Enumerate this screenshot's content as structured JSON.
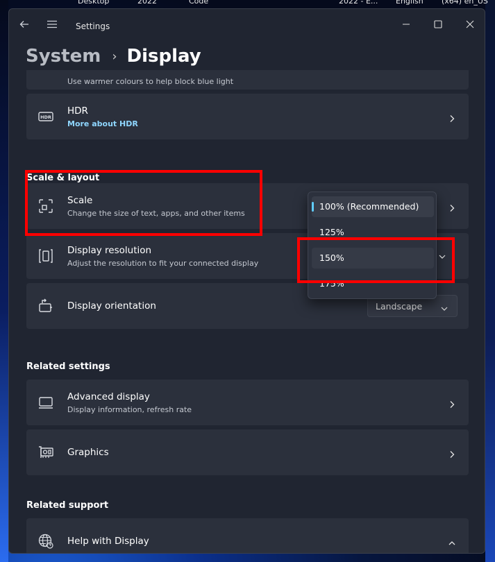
{
  "taskbar_labels": [
    "Desktop",
    "2022",
    "Code",
    "2022 - E...",
    "English",
    "(x64) en_US"
  ],
  "window": {
    "title": "Settings"
  },
  "breadcrumb": {
    "parent": "System",
    "separator": "›",
    "current": "Display"
  },
  "night_light": {
    "subtitle": "Use warmer colours to help block blue light"
  },
  "hdr": {
    "title": "HDR",
    "link": "More about HDR",
    "icon": "hdr-icon"
  },
  "scale_layout": {
    "heading": "Scale & layout",
    "scale": {
      "title": "Scale",
      "subtitle": "Change the size of text, apps, and other items",
      "icon": "scale-icon"
    },
    "resolution": {
      "title": "Display resolution",
      "subtitle": "Adjust the resolution to fit your connected display",
      "icon": "resolution-icon"
    },
    "orientation": {
      "title": "Display orientation",
      "value": "Landscape",
      "icon": "orientation-icon"
    }
  },
  "scale_dropdown": {
    "options": [
      "100% (Recommended)",
      "125%",
      "150%",
      "175%"
    ],
    "selected": "100% (Recommended)",
    "highlighted": "150%"
  },
  "related_settings": {
    "heading": "Related settings",
    "advanced": {
      "title": "Advanced display",
      "subtitle": "Display information, refresh rate",
      "icon": "monitor-icon"
    },
    "graphics": {
      "title": "Graphics",
      "icon": "graphics-card-icon"
    }
  },
  "related_support": {
    "heading": "Related support",
    "help": {
      "title": "Help with Display",
      "icon": "globe-help-icon"
    }
  },
  "colors": {
    "accent": "#60cdff",
    "link": "#8fd6ff",
    "annotation": "#ff0000",
    "card": "#2b303c",
    "window": "#202531"
  }
}
